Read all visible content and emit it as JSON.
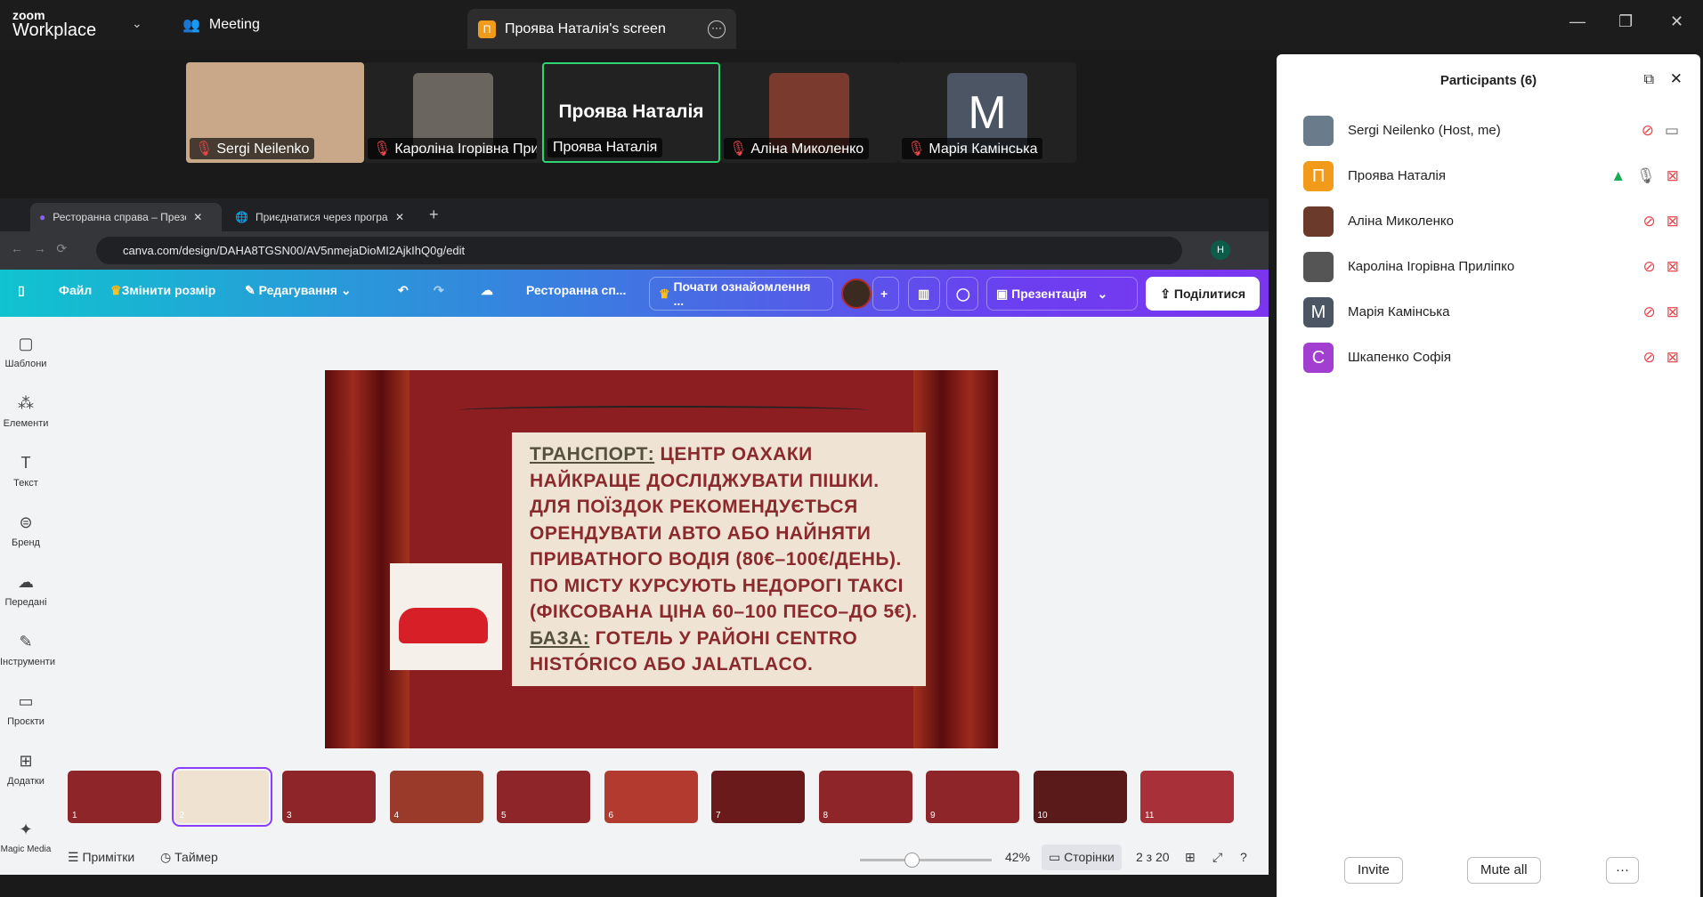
{
  "app": {
    "logo_top": "zoom",
    "logo_bottom": "Workplace",
    "meeting_label": "Meeting",
    "screen_tab": "Проява Наталія's screen",
    "screen_badge": "П"
  },
  "videos": [
    {
      "name": "Sergi Neilenko",
      "muted": true
    },
    {
      "name": "Кароліна Ігорівна Прилі...",
      "muted": true
    },
    {
      "name": "Проява Наталія",
      "muted": false,
      "active": true,
      "label": "Проява Наталія"
    },
    {
      "name": "Аліна Миколенко",
      "muted": true
    },
    {
      "name": "Марія Камінська",
      "muted": true,
      "initial": "M"
    }
  ],
  "browser": {
    "tabs": [
      "Ресторанна справа – Презентація",
      "Приєднатися через програму"
    ],
    "url": "canva.com/design/DAHA8TGSN00/AV5nmejaDioMI2AjkIhQ0g/edit",
    "profile": "H"
  },
  "canva": {
    "file": "Файл",
    "resize": "Змінити розмір",
    "editing": "Редагування",
    "title": "Ресторанна сп...",
    "trial": "Почати ознайомлення ...",
    "present": "Презентація",
    "share": "Поділитися",
    "sidebar": [
      "Шаблони",
      "Елементи",
      "Текст",
      "Бренд",
      "Передані",
      "Інструменти",
      "Проєкти",
      "Додатки",
      "Magic Media"
    ],
    "slide": {
      "l1a": "Транспорт:",
      "l1b": " центр Оахаки",
      "l2": "найкраще досліджувати пішки.",
      "l3": "Для поїздок  рекомендується",
      "l4": "орендувати авто або найняти",
      "l5": "приватного водія (80€–100€/день).",
      "l6": "По місту курсують недорогі таксі",
      "l7": "(фіксована ціна 60–100 песо–до 5€).",
      "l8a": "База:",
      "l8b": " готель у районі Centro",
      "l9": "Histórico або Jalatlaco."
    },
    "thumbs": [
      "1",
      "2",
      "3",
      "4",
      "5",
      "6",
      "7",
      "8",
      "9",
      "10",
      "11"
    ],
    "selected_page": 2,
    "notes": "Примітки",
    "timer": "Таймер",
    "zoom": "42%",
    "zoom_value": 42,
    "pages": "Сторінки",
    "page_count": "2 з 20"
  },
  "participants": {
    "title": "Participants (6)",
    "list": [
      {
        "name": "Sergi Neilenko (Host, me)",
        "color": "#6a7b8c",
        "initial": ""
      },
      {
        "name": "Проява Наталія",
        "color": "#f29a1a",
        "initial": "П"
      },
      {
        "name": "Аліна Миколенко",
        "color": "#6b3a2a",
        "initial": ""
      },
      {
        "name": "Кароліна Ігорівна Прилiпко",
        "color": "#555",
        "initial": ""
      },
      {
        "name": "Марія Камінська",
        "color": "#4b5563",
        "initial": "M"
      },
      {
        "name": "Шкапенко Софія",
        "color": "#a23fd1",
        "initial": "С"
      }
    ],
    "invite": "Invite",
    "mute_all": "Mute all",
    "more": "···"
  }
}
